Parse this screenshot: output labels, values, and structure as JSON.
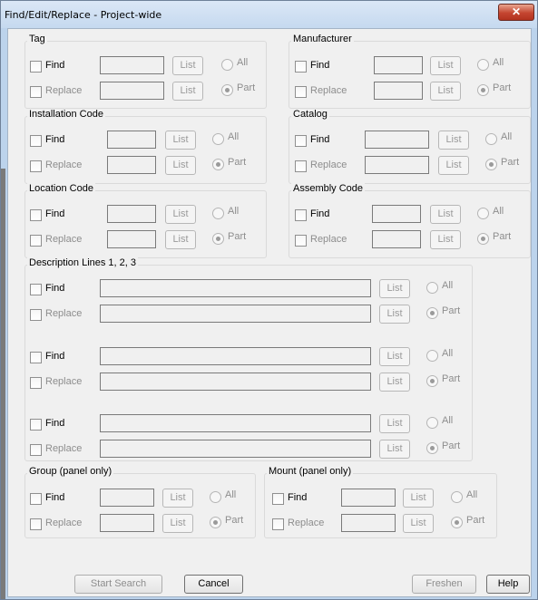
{
  "window": {
    "title": "Find/Edit/Replace - Project-wide",
    "close_glyph": "✕"
  },
  "common": {
    "find": "Find",
    "replace": "Replace",
    "list": "List",
    "all": "All",
    "part": "Part"
  },
  "groups": {
    "tag": "Tag",
    "manufacturer": "Manufacturer",
    "installation_code": "Installation Code",
    "catalog": "Catalog",
    "location_code": "Location Code",
    "assembly_code": "Assembly Code",
    "description_lines": "Description Lines 1, 2, 3",
    "group_panel": "Group (panel only)",
    "mount_panel": "Mount (panel only)"
  },
  "buttons": {
    "start_search": "Start Search",
    "cancel": "Cancel",
    "freshen": "Freshen",
    "help": "Help"
  }
}
